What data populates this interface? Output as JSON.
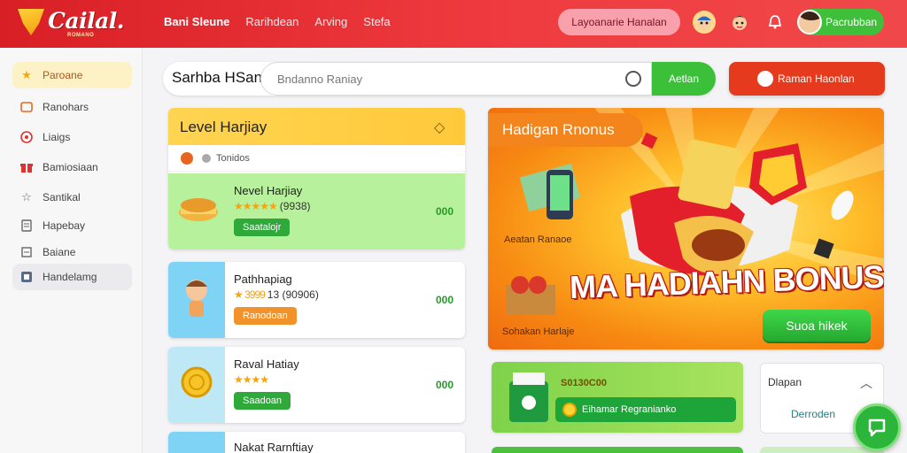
{
  "brand": {
    "logo_text": "Cailal.",
    "logo_sub": "ROMANO"
  },
  "topnav": [
    "Bani Sleune",
    "Rarihdean",
    "Arving",
    "Stefa"
  ],
  "top_pill": "Layoanarie Hanalan",
  "top_button": "Pacrubban",
  "sidebar": {
    "items": [
      {
        "label": "Paroane",
        "icon": "star-icon"
      },
      {
        "label": "Ranohars",
        "icon": "wallet-icon"
      },
      {
        "label": "Liaigs",
        "icon": "target-icon"
      },
      {
        "label": "Bamiosiaan",
        "icon": "gift-icon"
      },
      {
        "label": "Santikal",
        "icon": "star-outline-icon"
      },
      {
        "label": "Hapebay",
        "icon": "document-icon"
      },
      {
        "label": "Baiane",
        "icon": "list-icon"
      },
      {
        "label": "Handelamg",
        "icon": "box-icon"
      }
    ]
  },
  "search": {
    "title": "Sarhba HSan",
    "placeholder": "Bndanno Raniay",
    "button": "Aetlan"
  },
  "cta": {
    "label": "Raman Haonlan"
  },
  "level": {
    "title": "Level Harjiay",
    "sub": "Tonidos",
    "rows": [
      {
        "title": "Nevel Harjiay",
        "stars": "★★★★★",
        "rating": "(9938)",
        "button": "Saatalojr",
        "value": "000"
      },
      {
        "title": "Pathhapiag",
        "stars": "★ 3999",
        "rating": "13 (90906)",
        "button": "Ranodoan",
        "value": "000"
      },
      {
        "title": "Raval Hatiay",
        "stars": "★★★★",
        "rating": "",
        "button": "Saadoan",
        "value": "000"
      },
      {
        "title": "Nakat Rarnftiay"
      }
    ]
  },
  "banner": {
    "title": "Hadigan Rnonus",
    "caption1": "Aeatan Ranaoe",
    "caption2": "Sohakan Harlaje",
    "headline": "MA HADIAHN BONUS",
    "button": "Suoa hikek"
  },
  "promo": {
    "amount": "S0130C00",
    "button": "Eihamar Regranianko"
  },
  "dropdown": {
    "label": "Dlapan",
    "value": "Derroden"
  },
  "colors": {
    "brand_red": "#e12a2f",
    "accent_green": "#3cc03a",
    "accent_yellow": "#ffd451",
    "banner_orange": "#f78a12"
  }
}
